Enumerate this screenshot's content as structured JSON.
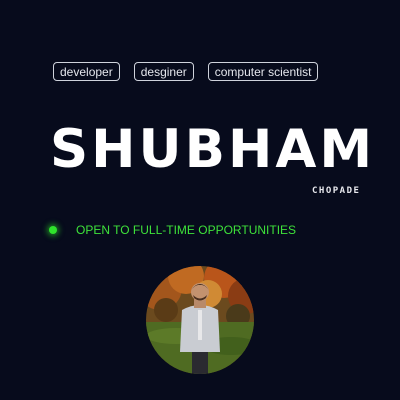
{
  "tags": [
    "developer",
    "desginer",
    "computer scientist"
  ],
  "hero": {
    "first_name": "SHUBHAM",
    "last_name": "CHOPADE"
  },
  "status": {
    "text": "OPEN TO FULL-TIME OPPORTUNITIES",
    "color": "#2fe22c"
  },
  "avatar": {
    "icon": "profile-photo"
  },
  "colors": {
    "background": "#070b1c",
    "text": "#ffffff",
    "accent": "#2fe22c"
  }
}
